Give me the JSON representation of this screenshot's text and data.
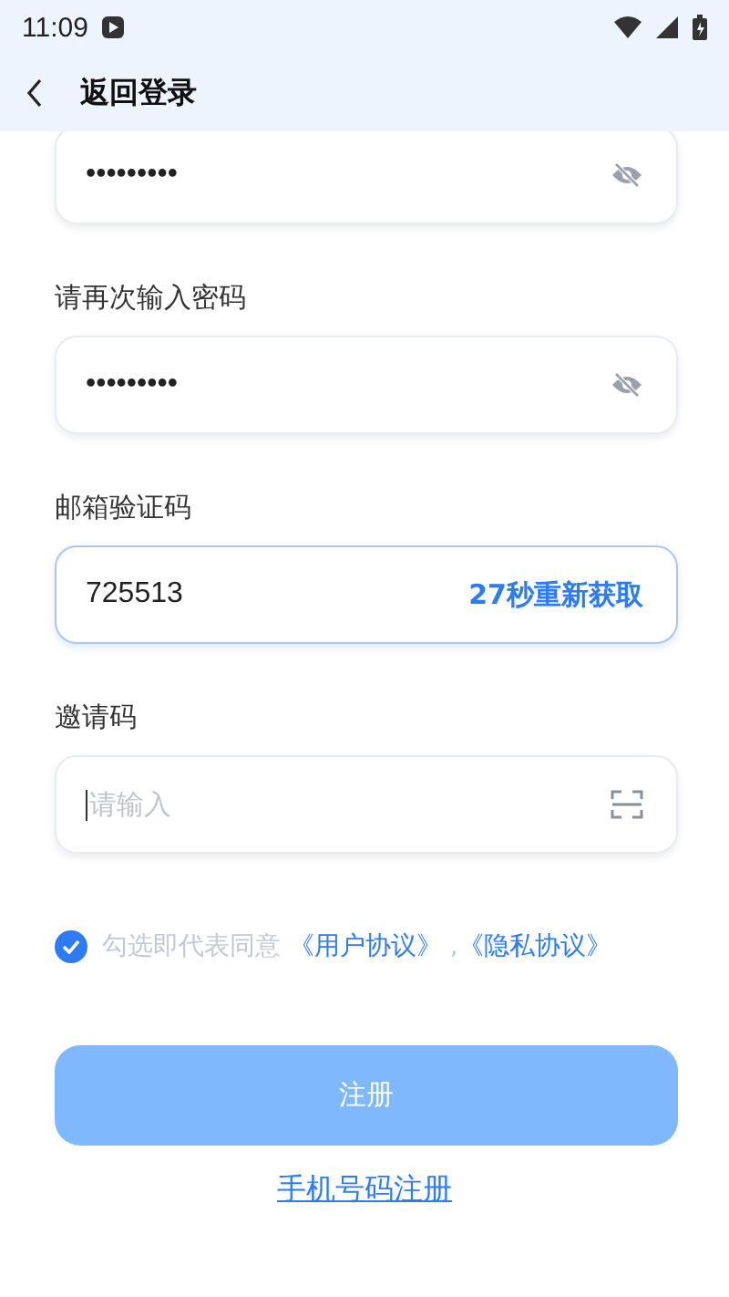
{
  "status_bar": {
    "time": "11:09"
  },
  "header": {
    "title": "返回登录"
  },
  "fields": [
    {
      "kind": "password",
      "value": "•••••••••",
      "active": false
    },
    {
      "kind": "password",
      "label": "请再次输入密码",
      "value": "•••••••••",
      "active": false
    },
    {
      "kind": "code",
      "label": "邮箱验证码",
      "value": "725513",
      "action": "27秒重新获取",
      "active": true
    },
    {
      "kind": "invite",
      "label": "邀请码",
      "placeholder": "请输入",
      "active": false
    }
  ],
  "agreement": {
    "checked": true,
    "text": "勾选即代表同意",
    "links": [
      "《用户协议》",
      "《隐私协议》"
    ],
    "separator": ","
  },
  "submit": {
    "label": "注册",
    "disabled": true
  },
  "alt_link": "手机号码注册"
}
